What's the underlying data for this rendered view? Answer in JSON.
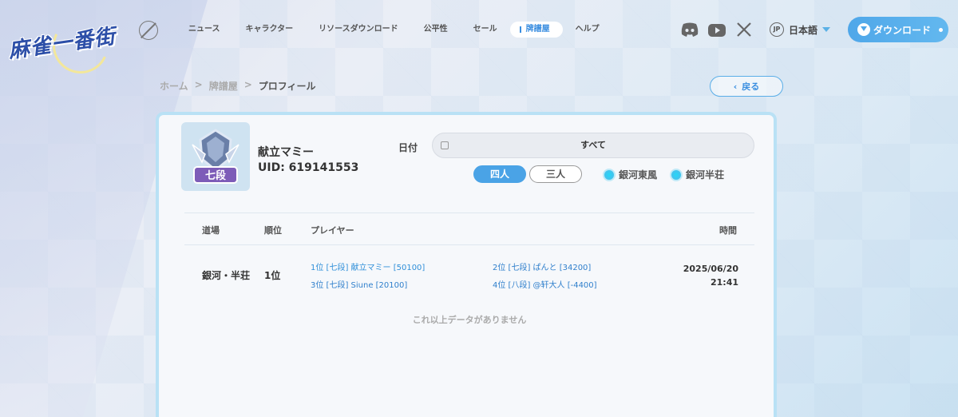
{
  "brand": {
    "logo_text": "麻雀一番街"
  },
  "nav": {
    "items": [
      {
        "label": "ニュース",
        "active": false
      },
      {
        "label": "キャラクター",
        "active": false
      },
      {
        "label": "リソースダウンロード",
        "active": false
      },
      {
        "label": "公平性",
        "active": false
      },
      {
        "label": "セール",
        "active": false
      },
      {
        "label": "牌譜屋",
        "active": true
      },
      {
        "label": "ヘルプ",
        "active": false
      }
    ]
  },
  "header": {
    "lang_code": "JP",
    "lang_label": "日本語",
    "download_label": "ダウンロード",
    "social": [
      "discord-icon",
      "youtube-icon",
      "x-icon"
    ]
  },
  "breadcrumb": {
    "home": "ホーム",
    "section": "牌譜屋",
    "current": "プロフィール",
    "separator": ">"
  },
  "back_label": "戻る",
  "profile": {
    "rank_badge_text": "七段",
    "name": "献立マミー",
    "uid": "UID: 619141553"
  },
  "filters": {
    "date_label": "日付",
    "date_value": "すべて",
    "mode_four": "四人",
    "mode_three": "三人",
    "room_east": "銀河東風",
    "room_south": "銀河半荘"
  },
  "table": {
    "headers": {
      "venue": "道場",
      "rank": "順位",
      "players": "プレイヤー",
      "time": "時間"
    },
    "rows": [
      {
        "venue": "銀河・半荘",
        "rank": "1位",
        "players": [
          "1位 [七段] 献立マミー [50100]",
          "2位 [七段] ぱんと [34200]",
          "3位 [七段] Siune [20100]",
          "4位 [八段] @轩大人 [-4400]"
        ],
        "date": "2025/06/20",
        "time": "21:41"
      }
    ],
    "no_more": "これ以上データがありません"
  },
  "colors": {
    "accent": "#4aa3e6",
    "link": "#2f8fd9",
    "card_border": "#b9e1f5"
  }
}
